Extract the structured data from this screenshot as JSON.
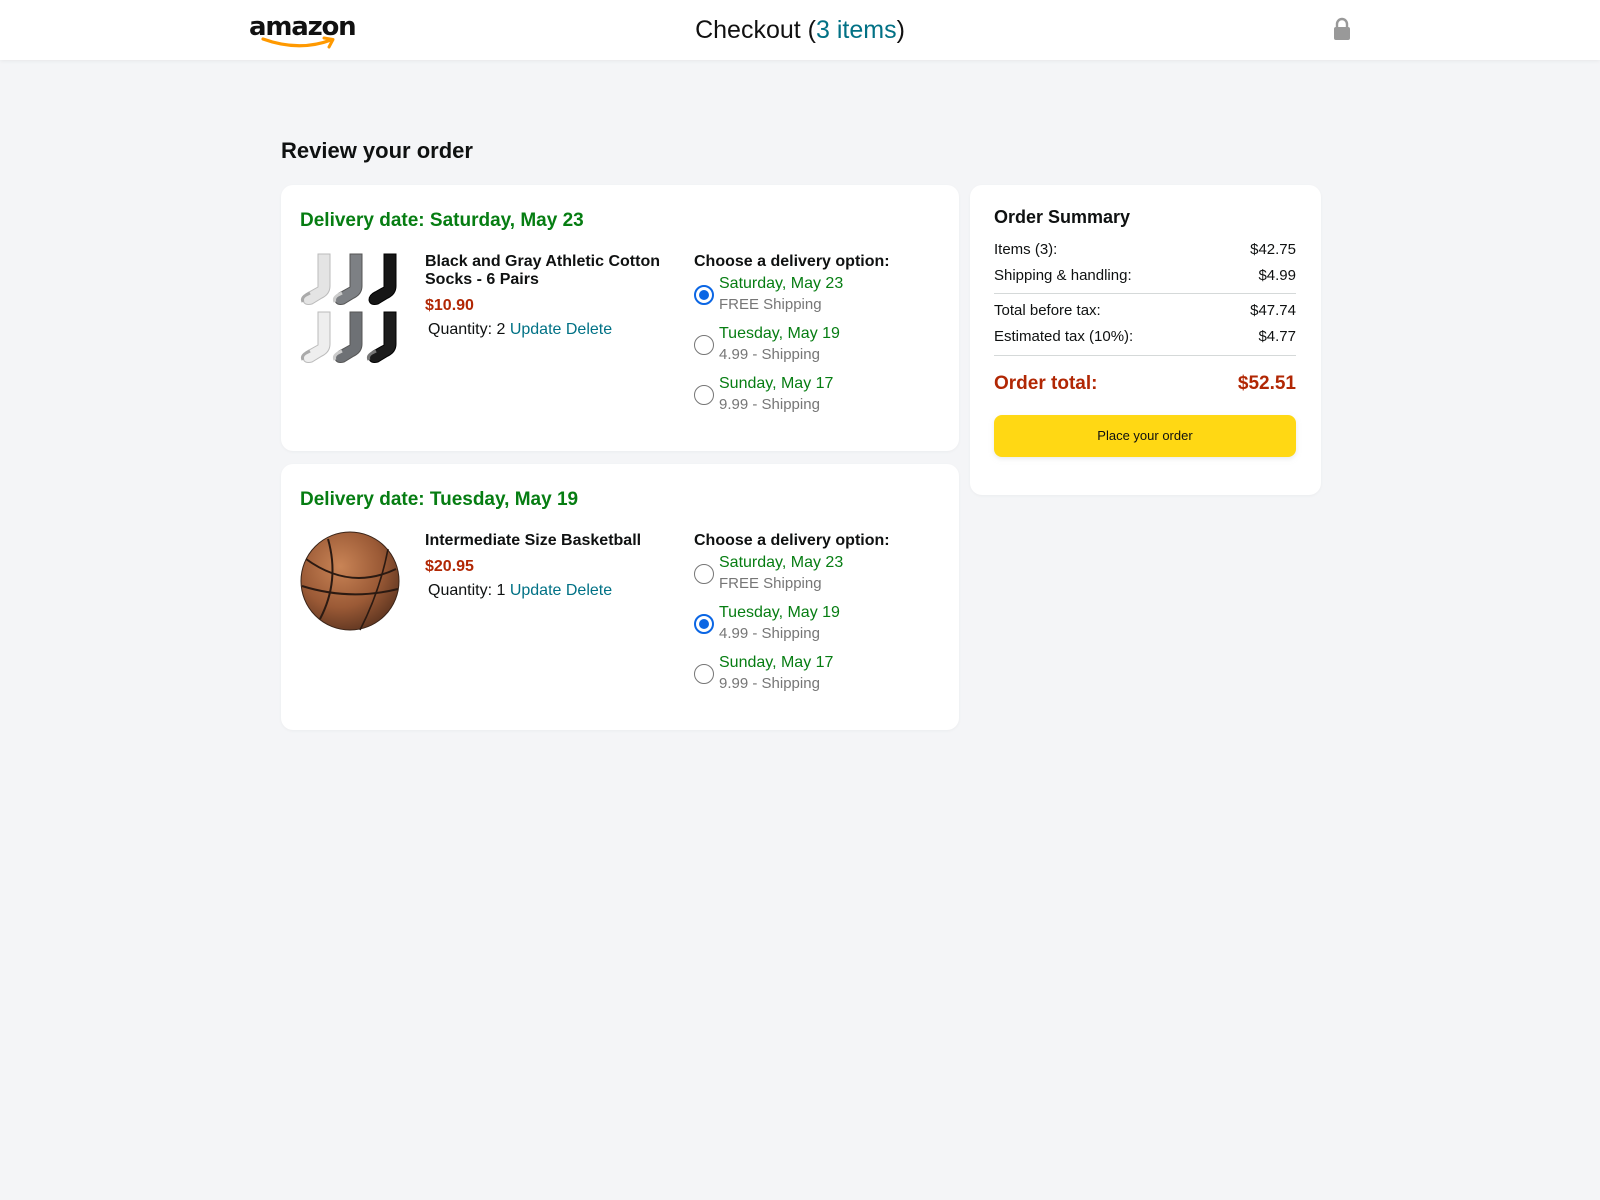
{
  "header": {
    "logo_text": "amazon",
    "title_prefix": "Checkout (",
    "item_count_label": "3 items",
    "title_suffix": ")",
    "lock_icon": "lock-icon"
  },
  "page_title": "Review your order",
  "items": [
    {
      "delivery_heading": "Delivery date: Saturday, May 23",
      "name": "Black and Gray Athletic Cotton Socks - 6 Pairs",
      "price": "$10.90",
      "quantity_label": "Quantity: 2",
      "update_label": "Update",
      "delete_label": "Delete",
      "options_title": "Choose a delivery option:",
      "options": [
        {
          "date": "Saturday, May 23",
          "shipping": "FREE Shipping",
          "selected": true
        },
        {
          "date": "Tuesday, May 19",
          "shipping": "4.99 - Shipping",
          "selected": false
        },
        {
          "date": "Sunday, May 17",
          "shipping": "9.99 - Shipping",
          "selected": false
        }
      ]
    },
    {
      "delivery_heading": "Delivery date: Tuesday, May 19",
      "name": "Intermediate Size Basketball",
      "price": "$20.95",
      "quantity_label": "Quantity: 1",
      "update_label": "Update",
      "delete_label": "Delete",
      "options_title": "Choose a delivery option:",
      "options": [
        {
          "date": "Saturday, May 23",
          "shipping": "FREE Shipping",
          "selected": false
        },
        {
          "date": "Tuesday, May 19",
          "shipping": "4.99 - Shipping",
          "selected": true
        },
        {
          "date": "Sunday, May 17",
          "shipping": "9.99 - Shipping",
          "selected": false
        }
      ]
    }
  ],
  "summary": {
    "title": "Order Summary",
    "items_label": "Items (3):",
    "items_value": "$42.75",
    "shipping_label": "Shipping & handling:",
    "shipping_value": "$4.99",
    "before_tax_label": "Total before tax:",
    "before_tax_value": "$47.74",
    "tax_label": "Estimated tax (10%):",
    "tax_value": "$4.77",
    "total_label": "Order total:",
    "total_value": "$52.51",
    "button_label": "Place your order"
  },
  "colors": {
    "delivery_green": "#067d12",
    "price_red": "#b12704",
    "link_teal": "#007185",
    "button_yellow": "#ffd814",
    "radio_blue": "#0b66e4"
  }
}
